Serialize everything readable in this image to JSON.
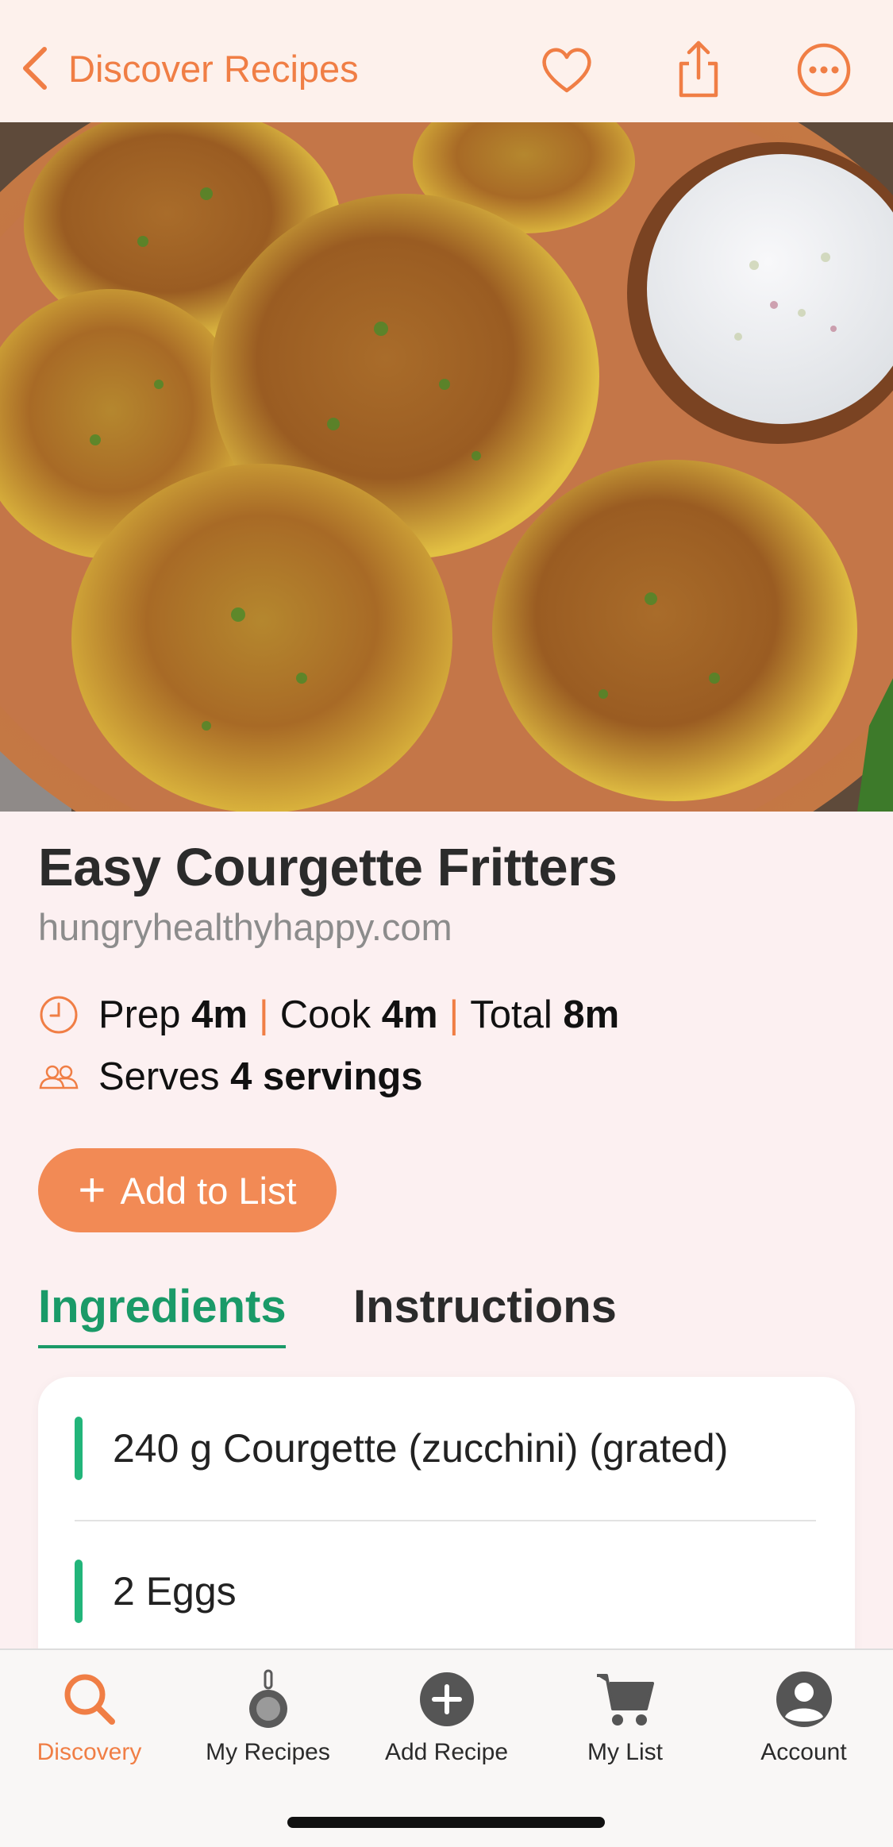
{
  "nav": {
    "back_label": "Discover Recipes",
    "back_icon": "chevron-left-icon",
    "icons": [
      "heart-icon",
      "share-icon",
      "more-icon"
    ]
  },
  "recipe": {
    "title": "Easy Courgette Fritters",
    "source": "hungryhealthyhappy.com",
    "prep_label": "Prep",
    "prep_value": "4m",
    "cook_label": "Cook",
    "cook_value": "4m",
    "total_label": "Total",
    "total_value": "8m",
    "separator": "|",
    "serves_label": "Serves",
    "serves_value": "4 servings"
  },
  "add_to_list": {
    "plus": "+",
    "label": "Add to List"
  },
  "tabs": [
    {
      "label": "Ingredients",
      "active": true
    },
    {
      "label": "Instructions",
      "active": false
    }
  ],
  "ingredients": [
    "240 g Courgette (zucchini) (grated)",
    "2 Eggs"
  ],
  "tabbar": [
    {
      "label": "Discovery",
      "icon": "search-icon",
      "active": true
    },
    {
      "label": "My Recipes",
      "icon": "pan-icon",
      "active": false
    },
    {
      "label": "Add Recipe",
      "icon": "add-circle-icon",
      "active": false
    },
    {
      "label": "My List",
      "icon": "cart-icon",
      "active": false
    },
    {
      "label": "Account",
      "icon": "account-icon",
      "active": false
    }
  ],
  "colors": {
    "accent": "#f07e45",
    "button": "#f28a55",
    "green": "#1a9a68",
    "background": "#fcf0f1"
  }
}
